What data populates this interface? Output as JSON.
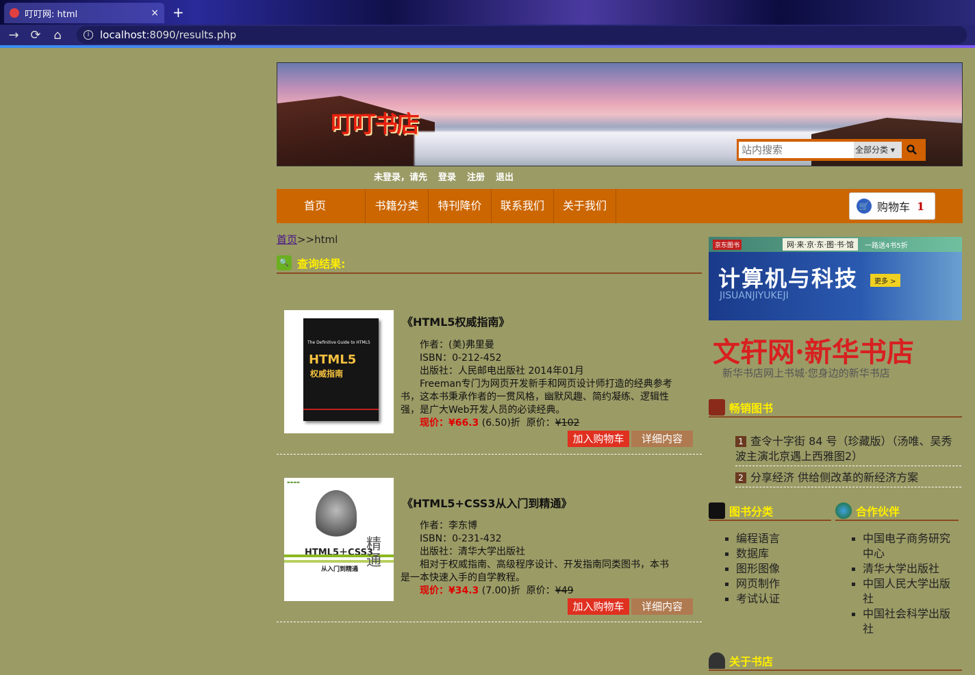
{
  "browser": {
    "tab_title": "叮叮网: html",
    "tab_close": "×",
    "new_tab": "+",
    "back": "→",
    "reload": "⟳",
    "home": "⌂",
    "url_host": "localhost",
    "url_rest": ":8090/results.php"
  },
  "header": {
    "logo": "叮叮书店",
    "search_placeholder": "站内搜索",
    "search_category": "全部分类 ▾"
  },
  "login": {
    "status": "未登录，请先",
    "login": "登录",
    "register": "注册",
    "logout": "退出"
  },
  "nav": {
    "items": [
      "首页",
      "书籍分类",
      "特刊降价",
      "联系我们",
      "关于我们"
    ],
    "cart_label": "购物车",
    "cart_count": "1"
  },
  "breadcrumb": {
    "home": "首页",
    "sep": ">>",
    "current": "html"
  },
  "results_title": "查询结果:",
  "books": [
    {
      "title": "《HTML5权威指南》",
      "author": "作者：(美)弗里曼",
      "isbn": "ISBN：0-212-452",
      "publisher": "出版社：人民邮电出版社 2014年01月",
      "desc_first": "Freeman专门为网页开发新手和网页设计师打造的经典参考",
      "desc_rest": "书，这本书秉承作者的一贯风格，幽默风趣、简约凝练、逻辑性强，是广大Web开发人员的必读经典。",
      "now_label": "现价：",
      "now_price": "¥66.3",
      "discount": " (6.50)折",
      "orig_label": "原价：",
      "orig_price": "¥102",
      "btn_cart": "加入购物车",
      "btn_detail": "详细内容",
      "cover_title": "HTML5",
      "cover_sub": "权威指南",
      "cover_eng": "The Definitive Guide to HTML5"
    },
    {
      "title": "《HTML5+CSS3从入门到精通》",
      "author": "作者：李东博",
      "isbn": "ISBN：0-231-432",
      "publisher": "出版社：清华大学出版社",
      "desc_first": "相对于权威指南、高级程序设计、开发指南同类图书，本书",
      "desc_rest": "是一本快速入手的自学教程。",
      "now_label": "现价：",
      "now_price": "¥34.3",
      "discount": " (7.00)折",
      "orig_label": "原价：",
      "orig_price": "¥49",
      "btn_cart": "加入购物车",
      "btn_detail": "详细内容",
      "cover_title": "HTML5＋CSS3",
      "cover_sub": "从入门到精通",
      "cover_char": "精通"
    }
  ],
  "ads": {
    "jd_tag": "京东图书",
    "jd_text": "网·来·京·东·图·书·馆",
    "jd_promo": "一路送4书5折",
    "tech_big": "计算机与科技",
    "tech_pinyin": "JISUANJIYUKEJI",
    "tech_more": "更多 >",
    "wx_big": "文轩网·新华书店",
    "wx_sub": "新华书店网上书城·您身边的新华书店"
  },
  "hot": {
    "title": "畅销图书",
    "items": [
      {
        "n": "1",
        "text": "查令十字街 84 号（珍藏版）（汤唯、吴秀波主演北京遇上西雅图2）"
      },
      {
        "n": "2",
        "text": "分享经济 供给侧改革的新经济方案"
      }
    ]
  },
  "categories": {
    "title": "图书分类",
    "items": [
      "编程语言",
      "数据库",
      "图形图像",
      "网页制作",
      "考试认证"
    ]
  },
  "partners": {
    "title": "合作伙伴",
    "items": [
      "中国电子商务研究中心",
      "清华大学出版社",
      "中国人民大学出版社",
      "中国社会科学出版社"
    ]
  },
  "about": {
    "title": "关于书店"
  }
}
